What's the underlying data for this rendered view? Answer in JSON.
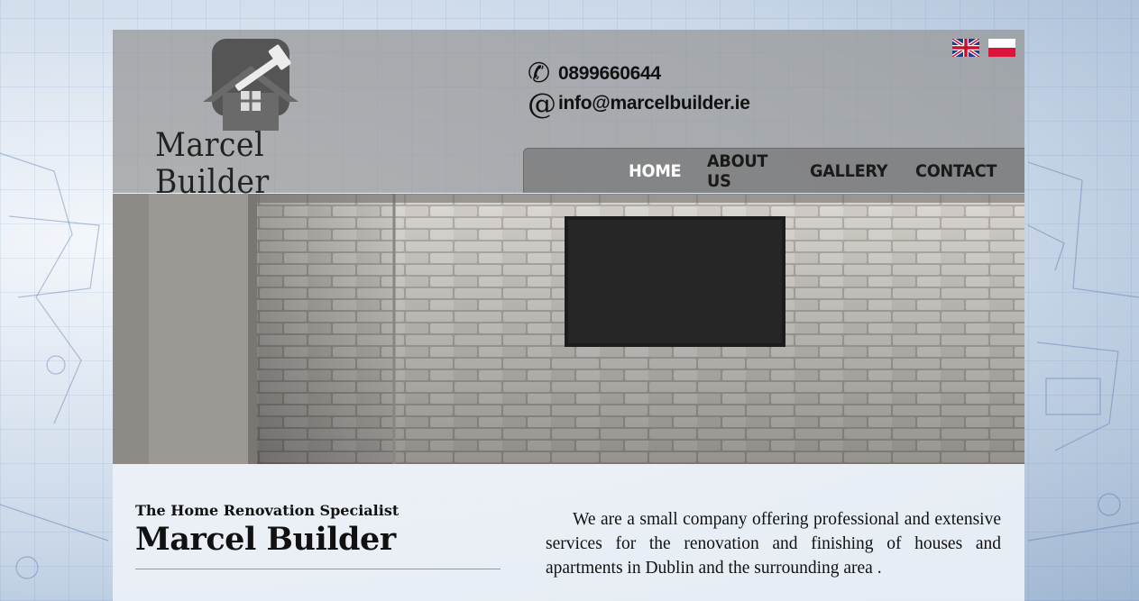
{
  "header": {
    "logo_text": "Marcel Builder",
    "phone": "0899660644",
    "email": "info@marcelbuilder.ie",
    "phone_icon": "phone-icon",
    "email_icon": "at-icon",
    "languages": [
      {
        "name": "uk-flag",
        "active": true
      },
      {
        "name": "poland-flag",
        "active": false
      }
    ]
  },
  "nav": {
    "items": [
      {
        "label": "HOME",
        "active": true
      },
      {
        "label": "ABOUT US",
        "active": false
      },
      {
        "label": "GALLERY",
        "active": false
      },
      {
        "label": "CONTACT",
        "active": false
      }
    ]
  },
  "intro": {
    "tagline": "The Home Renovation Specialist",
    "company": "Marcel Builder",
    "description": "We are a small company offering professional and extensive services for the renovation and finishing of houses and apartments in Dublin and the surrounding area ."
  },
  "colors": {
    "header_bg": "#969696",
    "nav_active": "#ffffff",
    "nav_text": "#1a1a1a"
  }
}
